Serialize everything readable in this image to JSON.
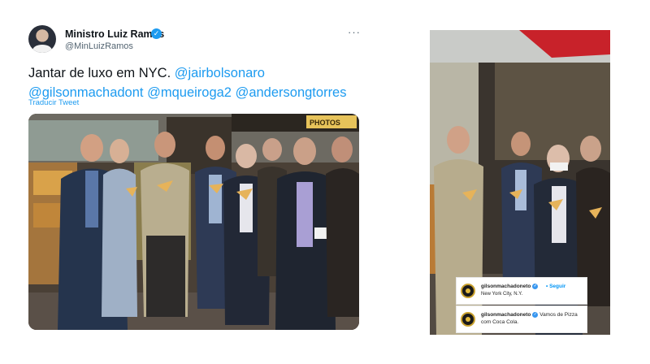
{
  "tweet": {
    "author_name": "Ministro Luiz Ramos",
    "handle": "@MinLuizRamos",
    "more_glyph": "···",
    "verified_glyph": "✓",
    "text_plain": "Jantar de luxo em NYC. ",
    "mentions": [
      "@jairbolsonaro",
      "@gilsonmachadont",
      "@mqueiroga2",
      "@andersongtorres"
    ],
    "translate_label": "Traducir Tweet",
    "photo_sign": "PHOTOS",
    "colors": {
      "link": "#1d9bf0",
      "text": "#0f1419",
      "muted": "#536471"
    }
  },
  "instagram": {
    "username": "gilsonmachadoneto",
    "verified_glyph": "✓",
    "follow_label": "• Seguir",
    "location": "New York City, N.Y.",
    "caption": "Vamos de Pizza com Coca Cola.",
    "colors": {
      "follow": "#0095f6",
      "verified": "#3897f0"
    }
  }
}
